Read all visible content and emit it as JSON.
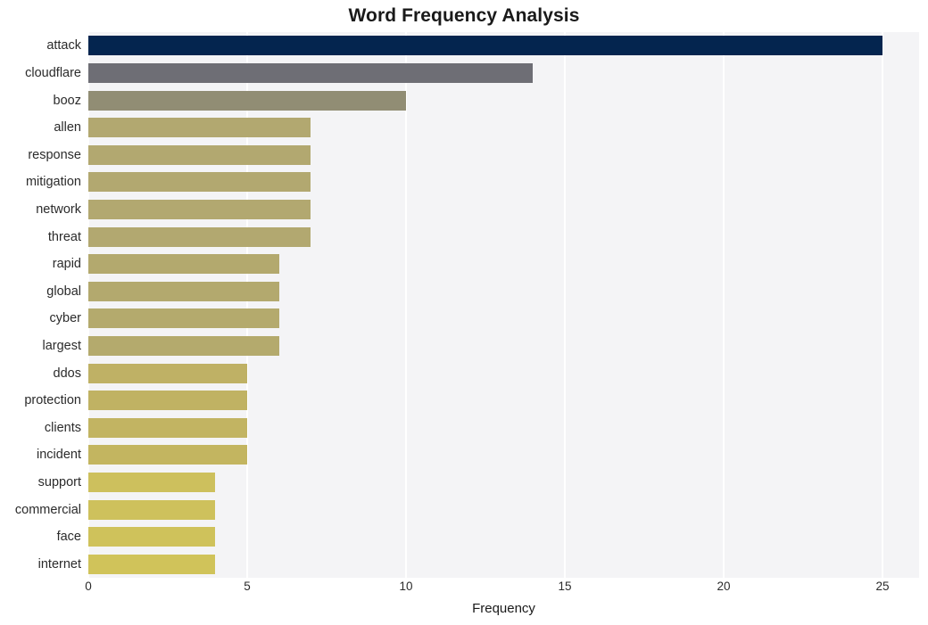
{
  "chart_data": {
    "type": "bar",
    "orientation": "horizontal",
    "title": "Word Frequency Analysis",
    "xlabel": "Frequency",
    "ylabel": "",
    "categories": [
      "attack",
      "cloudflare",
      "booz",
      "allen",
      "response",
      "mitigation",
      "network",
      "threat",
      "rapid",
      "global",
      "cyber",
      "largest",
      "ddos",
      "protection",
      "clients",
      "incident",
      "support",
      "commercial",
      "face",
      "internet"
    ],
    "values": [
      25,
      14,
      10,
      7,
      7,
      7,
      7,
      7,
      6,
      6,
      6,
      6,
      5,
      5,
      5,
      5,
      4,
      4,
      4,
      4
    ],
    "bar_colors": [
      "#04254f",
      "#6e6e75",
      "#918d74",
      "#b2a870",
      "#b2a870",
      "#b2a870",
      "#b2a870",
      "#b2a870",
      "#b3a96e",
      "#b3a96e",
      "#b4aa6d",
      "#b4aa6d",
      "#bfb165",
      "#c0b263",
      "#c2b462",
      "#c3b560",
      "#cdc05d",
      "#cec15c",
      "#cfc25b",
      "#d0c35a"
    ],
    "xlim": [
      0,
      26.15
    ],
    "xticks": [
      0,
      5,
      10,
      15,
      20,
      25
    ],
    "xtick_labels": [
      "0",
      "5",
      "10",
      "15",
      "20",
      "25"
    ],
    "grid": true,
    "grid_axis": "x",
    "legend": false,
    "plot_background": "#f4f4f6",
    "figure_background": "#ffffff",
    "gridline_color": "#ffffff"
  }
}
